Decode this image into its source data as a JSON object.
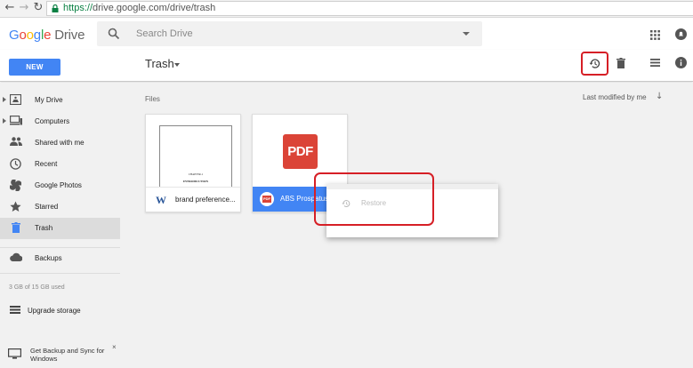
{
  "browser": {
    "url_scheme": "https://",
    "url_rest": "drive.google.com/drive/trash",
    "back_icon": "arrow-left-icon",
    "forward_icon": "arrow-right-icon",
    "reload_icon": "reload-icon"
  },
  "header": {
    "logo_letters": [
      "G",
      "o",
      "o",
      "g",
      "l",
      "e"
    ],
    "product": "Drive",
    "search_placeholder": "Search Drive"
  },
  "toolbar": {
    "new_label": "NEW",
    "breadcrumb": "Trash",
    "icons": [
      "restore-icon",
      "delete-forever-icon",
      "list-view-icon",
      "info-icon"
    ]
  },
  "sidebar": {
    "items": [
      {
        "label": "My Drive",
        "icon": "my-drive-icon",
        "expandable": true
      },
      {
        "label": "Computers",
        "icon": "computers-icon",
        "expandable": true
      },
      {
        "label": "Shared with me",
        "icon": "shared-icon",
        "expandable": false
      },
      {
        "label": "Recent",
        "icon": "clock-icon",
        "expandable": false
      },
      {
        "label": "Google Photos",
        "icon": "photos-icon",
        "expandable": false
      },
      {
        "label": "Starred",
        "icon": "star-icon",
        "expandable": false
      },
      {
        "label": "Trash",
        "icon": "trash-icon",
        "expandable": false,
        "active": true
      }
    ],
    "backups": "Backups",
    "storage": "3 GB of 15 GB used",
    "upgrade": "Upgrade storage",
    "promo_text": "Get Backup and Sync for Windows",
    "promo_close": "×"
  },
  "main": {
    "section_label": "Files",
    "sort_label": "Last modified by me",
    "files": [
      {
        "name": "brand preference...",
        "type": "word",
        "type_label": "W",
        "thumb_line1": "CHAPTER-1",
        "thumb_line2": "INTRODUCTION"
      },
      {
        "name": "ABS Prospatus",
        "type": "pdf",
        "type_label": "PDF",
        "selected": true
      }
    ]
  },
  "context_menu": {
    "items": [
      {
        "label": "Restore",
        "icon": "restore-icon",
        "disabled": true
      }
    ]
  },
  "colors": {
    "brand_blue": "#4285f4",
    "pdf_red": "#db4437",
    "highlight_red": "#d61f26",
    "sidebar_bg": "#f1f1f1"
  }
}
